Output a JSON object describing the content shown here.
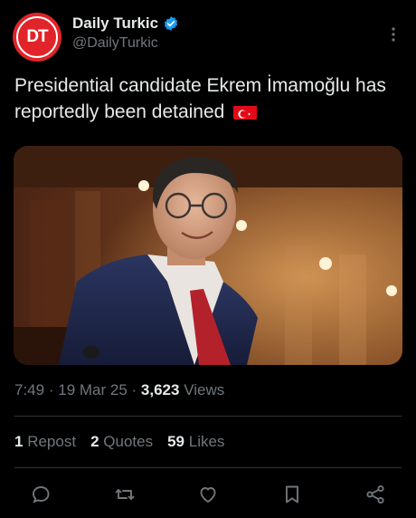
{
  "account": {
    "avatar_text": "DT",
    "display_name": "Daily Turkic",
    "handle": "@DailyTurkic",
    "verified": true,
    "avatar_color": "#e0242a",
    "verified_color": "#1d9bf0"
  },
  "tweet": {
    "text": "Presidential candidate Ekrem İmamoğlu has reportedly been detained",
    "flag_icon": "turkey-flag-icon"
  },
  "meta": {
    "time": "7:49",
    "separator": "·",
    "date": "19 Mar 25",
    "views_count": "3,623",
    "views_label": "Views"
  },
  "stats": {
    "reposts_count": "1",
    "reposts_label": "Repost",
    "quotes_count": "2",
    "quotes_label": "Quotes",
    "likes_count": "59",
    "likes_label": "Likes"
  },
  "actions": [
    "reply-icon",
    "repost-icon",
    "like-icon",
    "bookmark-icon",
    "share-icon"
  ]
}
